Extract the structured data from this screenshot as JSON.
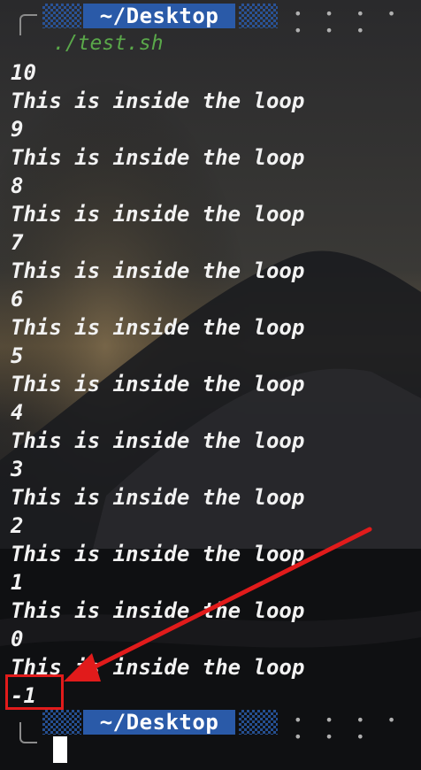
{
  "terminal": {
    "top_prompt": {
      "directory": "~/Desktop",
      "dots": "• • • • • • •"
    },
    "command": "./test.sh",
    "output_lines": [
      "10",
      "This is inside the loop",
      "9",
      "This is inside the loop",
      "8",
      "This is inside the loop",
      "7",
      "This is inside the loop",
      "6",
      "This is inside the loop",
      "5",
      "This is inside the loop",
      "4",
      "This is inside the loop",
      "3",
      "This is inside the loop",
      "2",
      "This is inside the loop",
      "1",
      "This is inside the loop",
      "0",
      "This is inside the loop",
      "-1"
    ],
    "bottom_prompt": {
      "directory": "~/Desktop",
      "dots": "• • • • • • •"
    }
  },
  "annotation": {
    "color": "#e11b1b"
  },
  "colors": {
    "prompt_blue": "#2a5aa8",
    "command_green": "#5aa84a",
    "text": "#f2f2f2"
  }
}
